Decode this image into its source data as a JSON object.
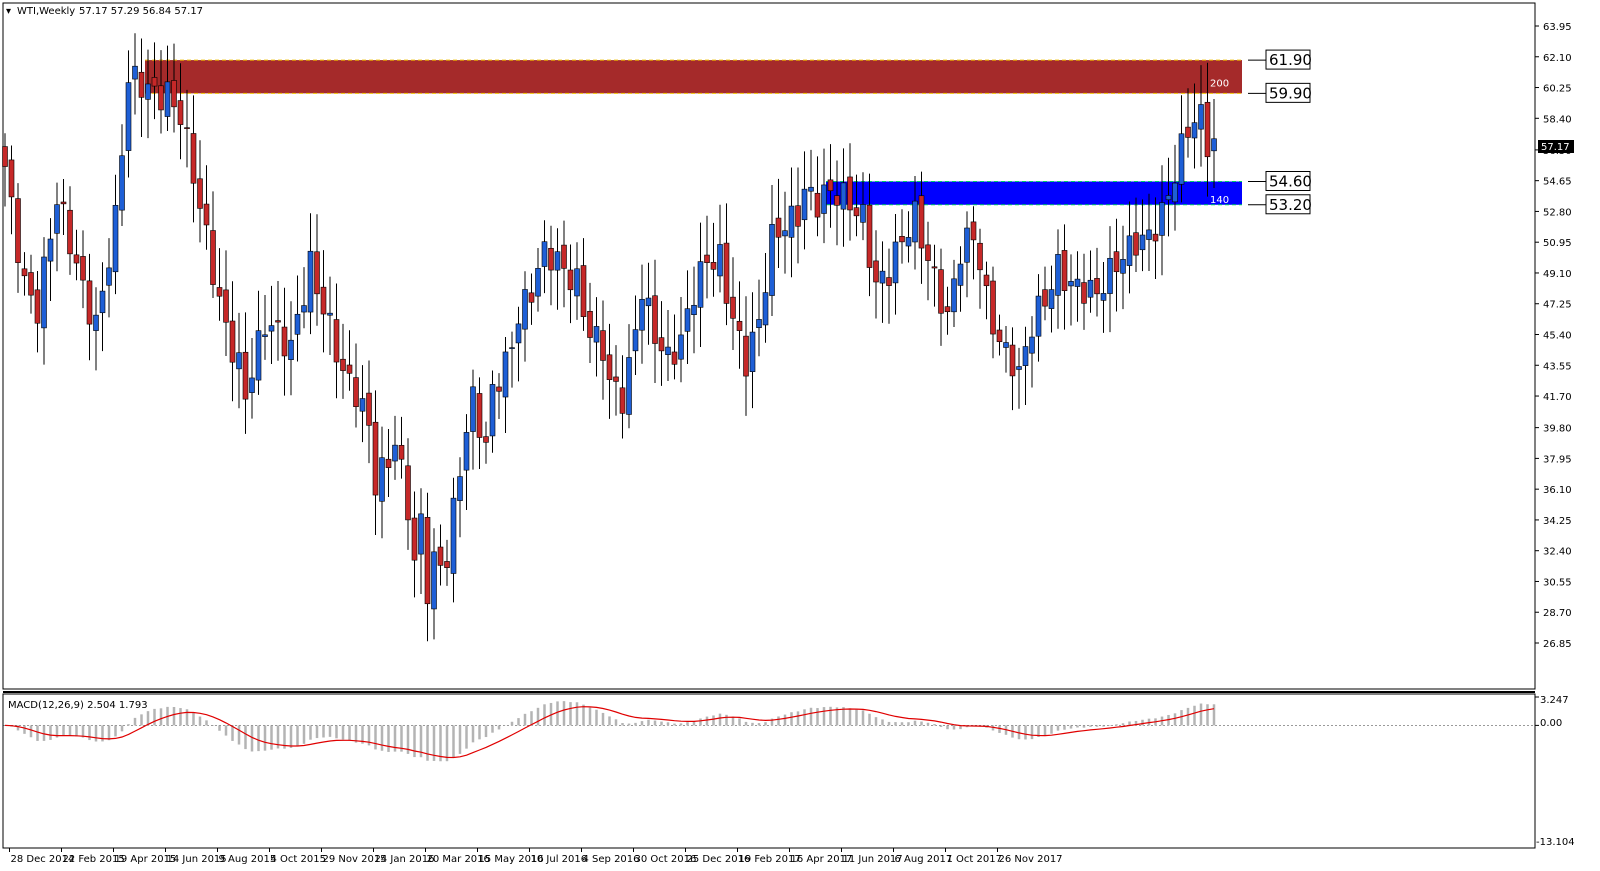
{
  "header": {
    "symbol": "WTI,Weekly",
    "ohlc": "57.17 57.29 56.84 57.17",
    "price_badge": "57.17"
  },
  "macd_panel": {
    "label": "MACD(12,26,9) 2.504 1.793",
    "axis": [
      "3.247",
      "0.00",
      "-13.104"
    ]
  },
  "zones": [
    {
      "name": "supply-zone",
      "color": "#a52a2a",
      "top": 61.9,
      "bottom": 59.9,
      "label": "200",
      "top_label": "61.90",
      "bottom_label": "59.90"
    },
    {
      "name": "demand-zone",
      "color": "#0000ff",
      "top": 54.6,
      "bottom": 53.2,
      "label": "140",
      "top_label": "54.60",
      "bottom_label": "53.20"
    }
  ],
  "colors": {
    "bull": "#1e5fd6",
    "bear": "#c62828",
    "wick": "#000000",
    "macd_signal": "#e00000",
    "macd_hist": "#b4b4b4"
  },
  "chart_data": {
    "type": "candlestick",
    "title": "WTI,Weekly",
    "y_axis_ticks": [
      "63.95",
      "62.10",
      "60.25",
      "58.40",
      "56.50",
      "54.65",
      "52.80",
      "50.95",
      "49.10",
      "47.25",
      "45.40",
      "43.55",
      "41.70",
      "39.80",
      "37.95",
      "36.10",
      "34.25",
      "32.40",
      "30.55",
      "28.70",
      "26.85"
    ],
    "ylim": [
      26.85,
      63.95
    ],
    "x_axis_labels": [
      "28 Dec 2014",
      "22 Feb 2015",
      "19 Apr 2015",
      "14 Jun 2015",
      "9 Aug 2015",
      "4 Oct 2015",
      "29 Nov 2015",
      "24 Jan 2016",
      "20 Mar 2016",
      "15 May 2016",
      "10 Jul 2016",
      "4 Sep 2016",
      "30 Oct 2016",
      "25 Dec 2016",
      "19 Feb 2017",
      "16 Apr 2017",
      "11 Jun 2017",
      "6 Aug 2017",
      "1 Oct 2017",
      "26 Nov 2017"
    ],
    "anchors": [
      [
        0,
        55.5
      ],
      [
        3,
        49.0
      ],
      [
        5,
        47.0
      ],
      [
        8,
        53.0
      ],
      [
        12,
        48.5
      ],
      [
        14,
        46.5
      ],
      [
        17,
        52.0
      ],
      [
        19,
        60.2
      ],
      [
        21,
        60.3
      ],
      [
        25,
        60.4
      ],
      [
        27,
        58.6
      ],
      [
        30,
        52.5
      ],
      [
        33,
        47.5
      ],
      [
        36,
        44.0
      ],
      [
        37,
        42.0
      ],
      [
        40,
        45.5
      ],
      [
        44,
        44.8
      ],
      [
        45,
        47.0
      ],
      [
        47,
        50.0
      ],
      [
        49,
        46.8
      ],
      [
        52,
        42.5
      ],
      [
        54,
        42.0
      ],
      [
        56,
        40.5
      ],
      [
        57,
        37.0
      ],
      [
        59,
        38.0
      ],
      [
        60,
        38.7
      ],
      [
        62,
        34.5
      ],
      [
        63,
        31.0
      ],
      [
        64,
        34.0
      ],
      [
        65,
        30.2
      ],
      [
        66,
        32.0
      ],
      [
        68,
        32.5
      ],
      [
        70,
        37.5
      ],
      [
        72,
        41.0
      ],
      [
        74,
        38.0
      ],
      [
        75,
        42.0
      ],
      [
        77,
        44.0
      ],
      [
        79,
        47.0
      ],
      [
        81,
        48.0
      ],
      [
        83,
        49.8
      ],
      [
        86,
        49.2
      ],
      [
        88,
        49.0
      ],
      [
        90,
        46.0
      ],
      [
        92,
        44.5
      ],
      [
        93,
        42.0
      ],
      [
        95,
        41.0
      ],
      [
        96,
        43.0
      ],
      [
        98,
        48.5
      ],
      [
        100,
        46.0
      ],
      [
        102,
        44.0
      ],
      [
        104,
        44.5
      ],
      [
        106,
        47.5
      ],
      [
        108,
        50.0
      ],
      [
        110,
        50.5
      ],
      [
        111,
        48.5
      ],
      [
        113,
        45.0
      ],
      [
        114,
        43.5
      ],
      [
        116,
        45.5
      ],
      [
        118,
        51.0
      ],
      [
        120,
        52.5
      ],
      [
        122,
        53.2
      ],
      [
        123,
        54.3
      ],
      [
        125,
        53.0
      ],
      [
        127,
        53.4
      ],
      [
        130,
        53.6
      ],
      [
        132,
        53.0
      ],
      [
        134,
        48.5
      ],
      [
        136,
        48.8
      ],
      [
        138,
        50.5
      ],
      [
        140,
        52.5
      ],
      [
        142,
        50.5
      ],
      [
        144,
        48.0
      ],
      [
        145,
        46.5
      ],
      [
        147,
        50.0
      ],
      [
        149,
        50.8
      ],
      [
        150,
        49.5
      ],
      [
        151,
        47.5
      ],
      [
        153,
        45.5
      ],
      [
        155,
        44.2
      ],
      [
        156,
        43.0
      ],
      [
        158,
        45.5
      ],
      [
        160,
        47.0
      ],
      [
        162,
        49.5
      ],
      [
        164,
        49.0
      ],
      [
        166,
        48.5
      ],
      [
        168,
        47.5
      ],
      [
        170,
        48.5
      ],
      [
        172,
        50.0
      ],
      [
        174,
        51.5
      ],
      [
        176,
        51.8
      ],
      [
        178,
        52.5
      ],
      [
        180,
        54.5
      ],
      [
        181,
        56.0
      ],
      [
        182,
        57.5
      ],
      [
        184,
        58.8
      ],
      [
        185,
        57.5
      ],
      [
        186,
        57.17
      ]
    ]
  }
}
